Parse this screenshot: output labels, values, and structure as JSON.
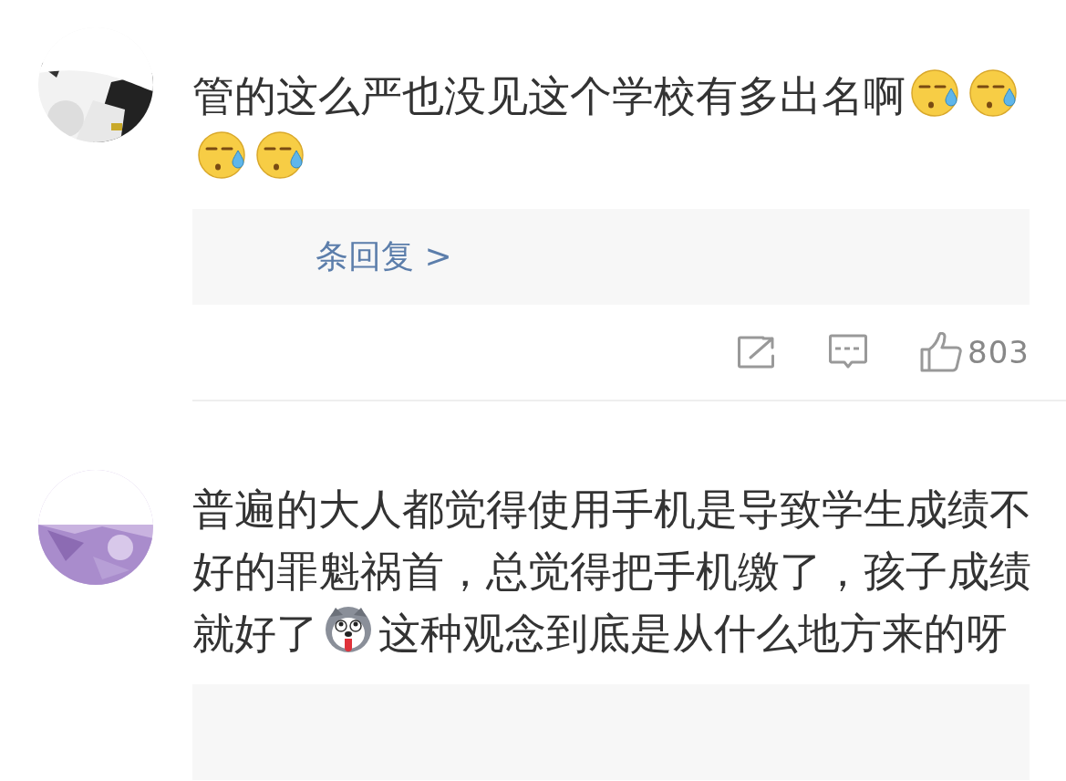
{
  "comments": [
    {
      "content": [
        {
          "kind": "text",
          "text": "管的这么严也没见这个学校有多出名啊"
        },
        {
          "kind": "sweat-face"
        },
        {
          "kind": "sweat-face"
        },
        {
          "kind": "sweat-face"
        },
        {
          "kind": "sweat-face"
        }
      ],
      "replies": {
        "kind": "panel",
        "label": "条回复 >"
      },
      "actions": {
        "like_count": "803"
      }
    },
    {
      "content": [
        {
          "kind": "text",
          "text": "普遍的大人都觉得使用手机是导致学生成绩不好的罪魁祸首，总觉得把手机缴了，孩子成绩就好了"
        },
        {
          "kind": "dog-face"
        },
        {
          "kind": "text",
          "text": "这种观念到底是从什么地方来的呀"
        }
      ],
      "replies": {
        "kind": "panel"
      }
    }
  ]
}
